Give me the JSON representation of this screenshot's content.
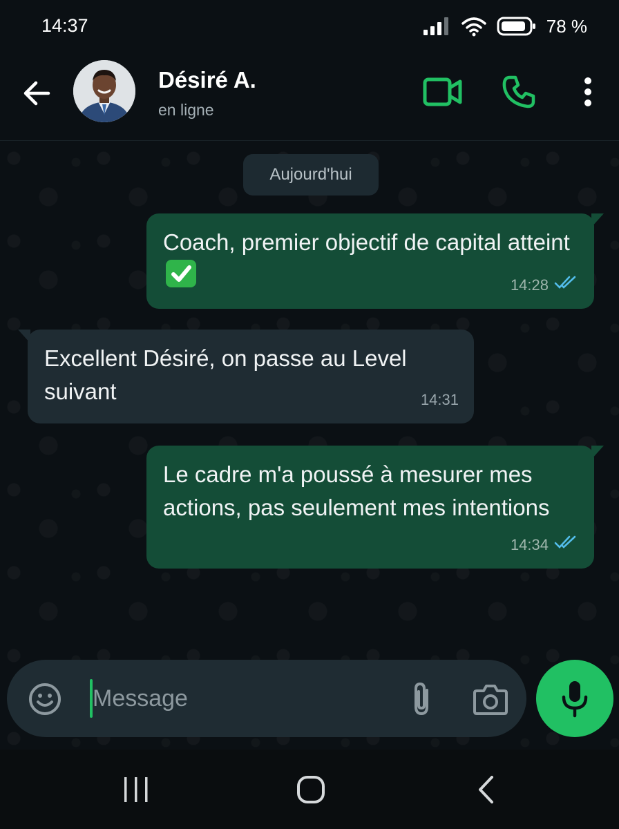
{
  "status_bar": {
    "time": "14:37",
    "battery_percent": "78 %",
    "icons": [
      "signal-icon",
      "wifi-icon",
      "battery-icon"
    ]
  },
  "header": {
    "contact_name": "Désiré A.",
    "contact_status": "en ligne",
    "icons": [
      "back-arrow-icon",
      "video-call-icon",
      "phone-icon",
      "more-vert-icon"
    ],
    "accent_color": "#21c063"
  },
  "chat": {
    "date_separator": "Aujourd'hui",
    "messages": [
      {
        "direction": "outgoing",
        "text": "Coach, premier objectif de capital atteint",
        "emoji": "check-mark-button-emoji",
        "time": "14:28",
        "status": "read"
      },
      {
        "direction": "incoming",
        "text": "Excellent Désiré, on passe au Level suivant",
        "time": "14:31"
      },
      {
        "direction": "outgoing",
        "text": "Le cadre m'a poussé à mesurer mes actions, pas seulement mes intentions",
        "time": "14:34",
        "status": "read"
      }
    ],
    "outgoing_bubble_color": "#144d37",
    "incoming_bubble_color": "#1f2c33",
    "read_tick_color": "#53bdeb"
  },
  "composer": {
    "placeholder": "Message",
    "value": "",
    "icons": [
      "emoji-icon",
      "attach-icon",
      "camera-icon",
      "mic-icon"
    ]
  },
  "nav_bar": {
    "icons": [
      "recents-icon",
      "home-icon",
      "back-icon"
    ]
  }
}
